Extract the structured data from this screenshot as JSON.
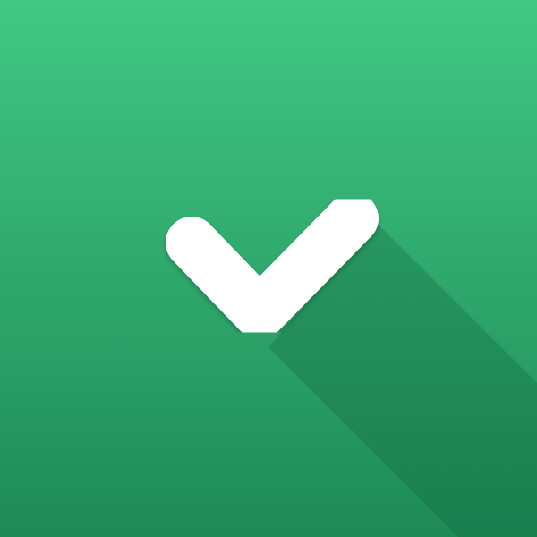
{
  "icon": {
    "name": "checkmark-icon",
    "colors": {
      "background_top": "#41C884",
      "background_bottom": "#1E8A57",
      "long_shadow": "#12633C",
      "glyph": "#FFFFFF"
    }
  }
}
